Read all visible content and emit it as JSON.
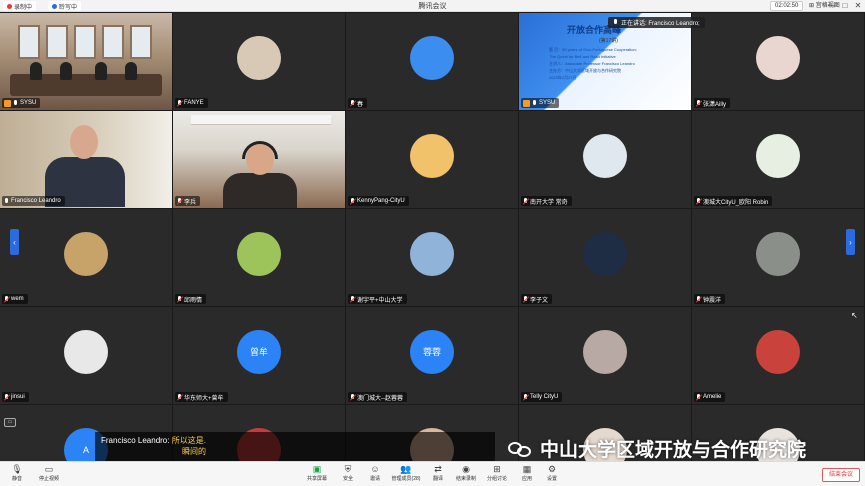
{
  "titlebar": {
    "title": "腾讯会议",
    "recording_badge": "录制中",
    "transcribing_badge": "聆写中",
    "timer": "02:02:50",
    "view_button": "宫格视图",
    "window_controls": [
      "—",
      "□",
      "✕"
    ]
  },
  "speaking_banner": "正在讲话: Francisco Leandro;",
  "slide": {
    "title": "开放合作高峰",
    "issue": "(第17讲)",
    "lines": [
      "题 目：50 years of Sino-Portuguese Cooperation:",
      "The Quest for Belt and Road Initiative",
      "主讲人：Associate Professor Francisco Leandro",
      "主办方：中山大学区域开放与合作研究院",
      "2023年2月27日"
    ]
  },
  "tiles": [
    {
      "name": "SYSU",
      "mic": "on",
      "host": true,
      "type": "room"
    },
    {
      "name": "FANYE",
      "mic": "off",
      "type": "avatar",
      "color": "#d8c9b6"
    },
    {
      "name": "春",
      "mic": "off",
      "type": "avatar",
      "color": "#3b8ef0",
      "initial": ""
    },
    {
      "name": "SYSU",
      "mic": "on",
      "host": true,
      "type": "slide"
    },
    {
      "name": "张潇Ailly",
      "mic": "off",
      "type": "avatar",
      "color": "#e9d6d0"
    },
    {
      "name": "Francisco Leandro",
      "mic": "on",
      "speaker": true,
      "type": "office"
    },
    {
      "name": "李兵",
      "mic": "off",
      "type": "studio"
    },
    {
      "name": "KennyPang-CityU",
      "mic": "off",
      "type": "avatar",
      "color": "#f2c26a"
    },
    {
      "name": "南开大学 常奇",
      "mic": "off",
      "type": "avatar",
      "color": "#dfe7ef"
    },
    {
      "name": "澳城大CityU_欧阳 Robin",
      "mic": "off",
      "type": "avatar",
      "color": "#e7efe2"
    },
    {
      "name": "wem",
      "mic": "off",
      "type": "avatar",
      "color": "#c7a36a"
    },
    {
      "name": "邱雨情",
      "mic": "off",
      "type": "avatar",
      "color": "#9cc45a"
    },
    {
      "name": "谢宇平+中山大学",
      "mic": "off",
      "type": "avatar",
      "color": "#8fb3d9"
    },
    {
      "name": "李子文",
      "mic": "off",
      "type": "avatar",
      "color": "#1e2c44"
    },
    {
      "name": "钟震洋",
      "mic": "off",
      "type": "avatar",
      "color": "#8b8f8a"
    },
    {
      "name": "jinsui",
      "mic": "off",
      "type": "avatar",
      "color": "#e8e8e8"
    },
    {
      "name": "华东师大+曾牟",
      "mic": "off",
      "type": "avatar",
      "color": "#2b83f6",
      "initial": "曾牟"
    },
    {
      "name": "澳门城大--赵蓉蓉",
      "mic": "off",
      "type": "avatar",
      "color": "#2b83f6",
      "initial": "蓉蓉"
    },
    {
      "name": "Telly CityU",
      "mic": "off",
      "type": "avatar",
      "color": "#b8a9a4"
    },
    {
      "name": "Amelie",
      "mic": "off",
      "type": "avatar",
      "color": "#c9423c"
    },
    {
      "name": "",
      "mic": "none",
      "type": "avatar",
      "color": "#2b83f6",
      "initial": "A"
    },
    {
      "name": "",
      "mic": "none",
      "type": "avatar",
      "color": "#c63b3b"
    },
    {
      "name": "",
      "mic": "none",
      "type": "avatar",
      "color": "#d9b79c"
    },
    {
      "name": "",
      "mic": "none",
      "type": "avatar",
      "color": "#e4d9cf"
    },
    {
      "name": "",
      "mic": "none",
      "type": "avatar",
      "color": "#e9e3de"
    }
  ],
  "subtitle": {
    "speaker": "Francisco Leandro:",
    "line1": "所以这是.",
    "line2": "瞬间的"
  },
  "watermark": "中山大学区域开放与合作研究院",
  "toolbar": {
    "left": [
      {
        "label": "静音",
        "icon": "microphone-icon",
        "glyph": "🎙"
      },
      {
        "label": "停止视频",
        "icon": "video-icon",
        "glyph": "▭"
      }
    ],
    "center": [
      {
        "label": "共享屏幕",
        "icon": "share-screen-icon",
        "glyph": "▣",
        "active": true
      },
      {
        "label": "安全",
        "icon": "shield-icon",
        "glyph": "⛨"
      },
      {
        "label": "邀请",
        "icon": "invite-icon",
        "glyph": "☺"
      },
      {
        "label": "管理成员(28)",
        "icon": "members-icon",
        "glyph": "👥"
      },
      {
        "label": "翻译",
        "icon": "translate-icon",
        "glyph": "⇄"
      },
      {
        "label": "结束录制",
        "icon": "record-icon",
        "glyph": "◉"
      },
      {
        "label": "分组讨论",
        "icon": "breakout-icon",
        "glyph": "⊞"
      },
      {
        "label": "应用",
        "icon": "apps-icon",
        "glyph": "▦"
      },
      {
        "label": "设置",
        "icon": "settings-icon",
        "glyph": "⚙"
      }
    ],
    "end_button": "结束会议"
  }
}
